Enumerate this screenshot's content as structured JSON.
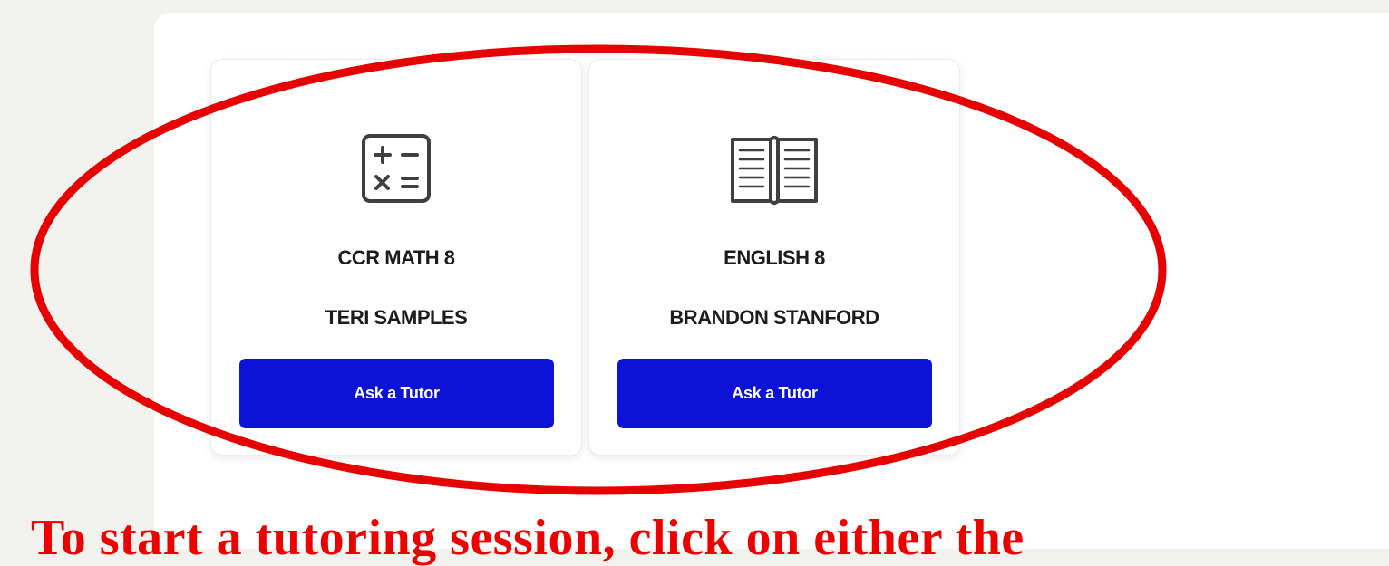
{
  "cards": [
    {
      "icon": "calculator-icon",
      "course": "CCR MATH 8",
      "teacher": "TERI SAMPLES",
      "button_label": "Ask a Tutor"
    },
    {
      "icon": "open-book-icon",
      "course": "ENGLISH 8",
      "teacher": "BRANDON STANFORD",
      "button_label": "Ask a Tutor"
    }
  ],
  "annotation": {
    "caption": "To start a tutoring session, click on either the",
    "highlight_color": "#e60000"
  },
  "colors": {
    "button": "#0c12d6",
    "background": "#f2f2ee"
  }
}
